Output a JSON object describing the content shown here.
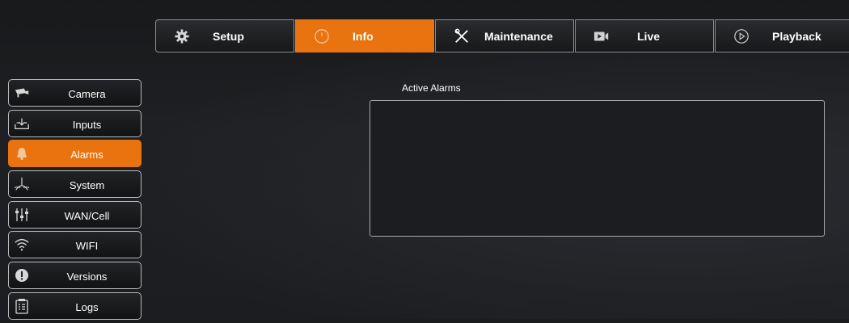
{
  "top_tabs": {
    "setup": {
      "label": "Setup",
      "icon": "gear-icon"
    },
    "info": {
      "label": "Info",
      "icon": "clock-icon"
    },
    "maintenance": {
      "label": "Maintenance",
      "icon": "tools-icon"
    },
    "live": {
      "label": "Live",
      "icon": "video-camera-icon"
    },
    "playback": {
      "label": "Playback",
      "icon": "playback-icon"
    },
    "active": "info"
  },
  "sidebar": {
    "items": [
      {
        "label": "Camera",
        "icon": "camera-icon"
      },
      {
        "label": "Inputs",
        "icon": "inputs-icon"
      },
      {
        "label": "Alarms",
        "icon": "bell-icon"
      },
      {
        "label": "System",
        "icon": "system-icon"
      },
      {
        "label": "WAN/Cell",
        "icon": "sliders-icon"
      },
      {
        "label": "WIFI",
        "icon": "wifi-icon"
      },
      {
        "label": "Versions",
        "icon": "info-icon"
      },
      {
        "label": "Logs",
        "icon": "logs-icon"
      }
    ],
    "active_index": 2
  },
  "main": {
    "title": "Active Alarms",
    "alarms": []
  },
  "colors": {
    "accent": "#e8730f",
    "background": "#1b1c1e",
    "border": "#b9b9b9"
  }
}
